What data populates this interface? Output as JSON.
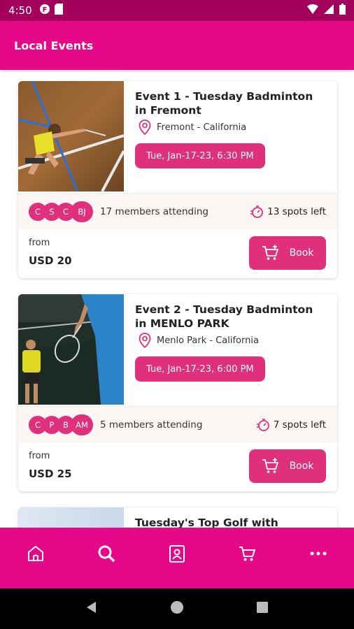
{
  "status_bar": {
    "time": "4:50"
  },
  "app_bar": {
    "title": "Local Events"
  },
  "events": [
    {
      "title": "Event 1 - Tuesday Badminton in Fremont",
      "location": "Fremont - California",
      "date": "Tue, Jan-17-23, 6:30 PM",
      "attendees": [
        "C",
        "S",
        "C",
        "BJ"
      ],
      "attending_text": "17 members attending",
      "spots_text": "13 spots left",
      "from_label": "from",
      "price": "USD 20",
      "book_label": "Book"
    },
    {
      "title": "Event 2  - Tuesday Badminton in MENLO PARK",
      "location": "Menlo Park - California",
      "date": "Tue, Jan-17-23, 6:00 PM",
      "attendees": [
        "C",
        "P",
        "B",
        "AM"
      ],
      "attending_text": "5 members attending",
      "spots_text": "7 spots left",
      "from_label": "from",
      "price": "USD 25",
      "book_label": "Book"
    },
    {
      "title": "Tuesday's Top Golf with ZOYIZM"
    }
  ],
  "bottom_nav": {
    "items": [
      {
        "icon": "home-icon"
      },
      {
        "icon": "search-icon"
      },
      {
        "icon": "profile-card-icon"
      },
      {
        "icon": "cart-icon"
      },
      {
        "icon": "more-icon"
      }
    ]
  },
  "colors": {
    "primary": "#e5098a",
    "accent": "#e0307c",
    "status": "#a3005c"
  }
}
